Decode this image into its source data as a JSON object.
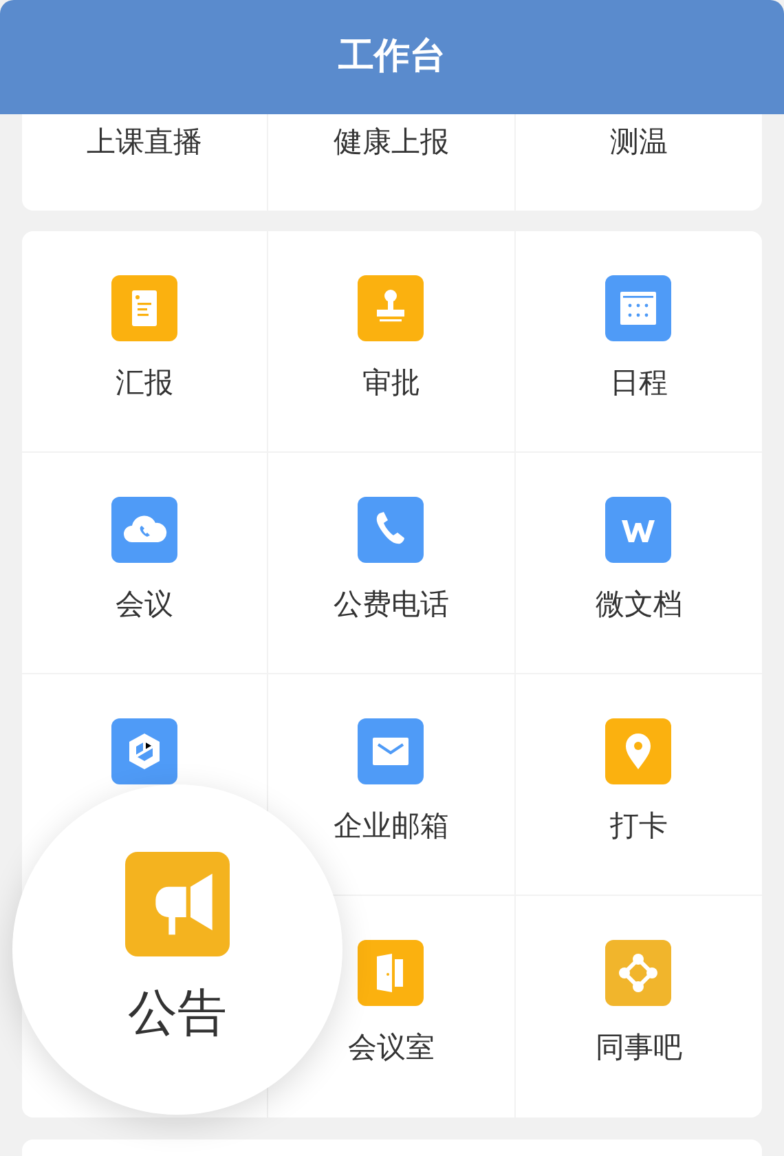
{
  "header": {
    "title": "工作台"
  },
  "top_items": [
    {
      "label": "上课直播"
    },
    {
      "label": "健康上报"
    },
    {
      "label": "测温"
    }
  ],
  "apps": [
    {
      "kind": "app",
      "label": "汇报",
      "color": "#fbb10f"
    },
    {
      "kind": "app",
      "label": "审批",
      "color": "#fbb10f"
    },
    {
      "kind": "app",
      "label": "日程",
      "color": "#4f9bf7"
    },
    {
      "kind": "app",
      "label": "会议",
      "color": "#4f9bf7"
    },
    {
      "kind": "app",
      "label": "公费电话",
      "color": "#4f9bf7"
    },
    {
      "kind": "app",
      "label": "微文档",
      "color": "#4f9bf7"
    },
    {
      "kind": "app",
      "color": "#4f9bf7"
    },
    {
      "kind": "app",
      "label": "企业邮箱",
      "color": "#4f9bf7"
    },
    {
      "kind": "app",
      "label": "打卡",
      "color": "#fbb10f"
    },
    {
      "kind": "blank"
    },
    {
      "kind": "app",
      "label": "会议室",
      "color": "#fbb10f"
    },
    {
      "kind": "app",
      "label": "同事吧",
      "color": "#f1b52c"
    }
  ],
  "magnifier": {
    "label": "公告",
    "color": "#f4b31f"
  }
}
